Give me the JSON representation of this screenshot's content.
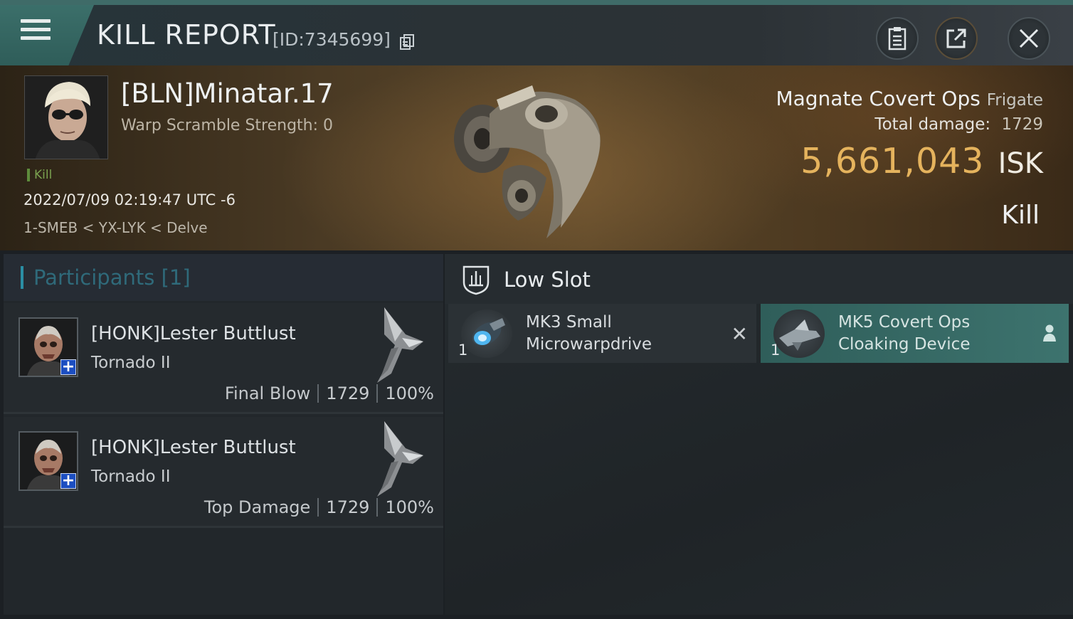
{
  "header": {
    "title": "KILL REPORT",
    "report_id": "[ID:7345699]"
  },
  "icons": {
    "menu": "hamburger-menu-icon",
    "copy": "copy-icon",
    "report": "clipboard-icon",
    "share": "share-icon",
    "close": "close-icon",
    "low_slot": "low-slot-shield-icon",
    "destroyed": "x-mark-icon",
    "dropped": "person-icon"
  },
  "victim": {
    "name": "[BLN]Minatar.17",
    "warp_scramble": "Warp Scramble Strength: 0",
    "tag": "Kill",
    "datetime": "2022/07/09 02:19:47 UTC -6",
    "location": "1-SMEB < YX-LYK < Delve",
    "ship_name": "Magnate Covert Ops",
    "ship_class": "Frigate",
    "total_damage_label": "Total damage:",
    "total_damage": "1729",
    "isk_value": "5,661,043",
    "isk_unit": "ISK",
    "result": "Kill"
  },
  "participants": {
    "title": "Participants",
    "count": "[1]",
    "rows": [
      {
        "name": "[HONK]Lester Buttlust",
        "ship": "Tornado II",
        "role": "Final Blow",
        "damage": "1729",
        "percent": "100%"
      },
      {
        "name": "[HONK]Lester Buttlust",
        "ship": "Tornado II",
        "role": "Top Damage",
        "damage": "1729",
        "percent": "100%"
      }
    ]
  },
  "fitting": {
    "slot_title": "Low Slot",
    "modules": [
      {
        "qty": "1",
        "line1": "MK3 Small",
        "line2": "Microwarpdrive",
        "status": "destroyed"
      },
      {
        "qty": "1",
        "line1": "MK5 Covert Ops",
        "line2": "Cloaking Device",
        "status": "dropped"
      }
    ]
  },
  "colors": {
    "accent_teal": "#3f6b68",
    "isk_gold": "#e5b35d",
    "kill_green": "#7aa14f",
    "participants_blue": "#2b8ea4",
    "dropped_green": "#3d736e"
  }
}
